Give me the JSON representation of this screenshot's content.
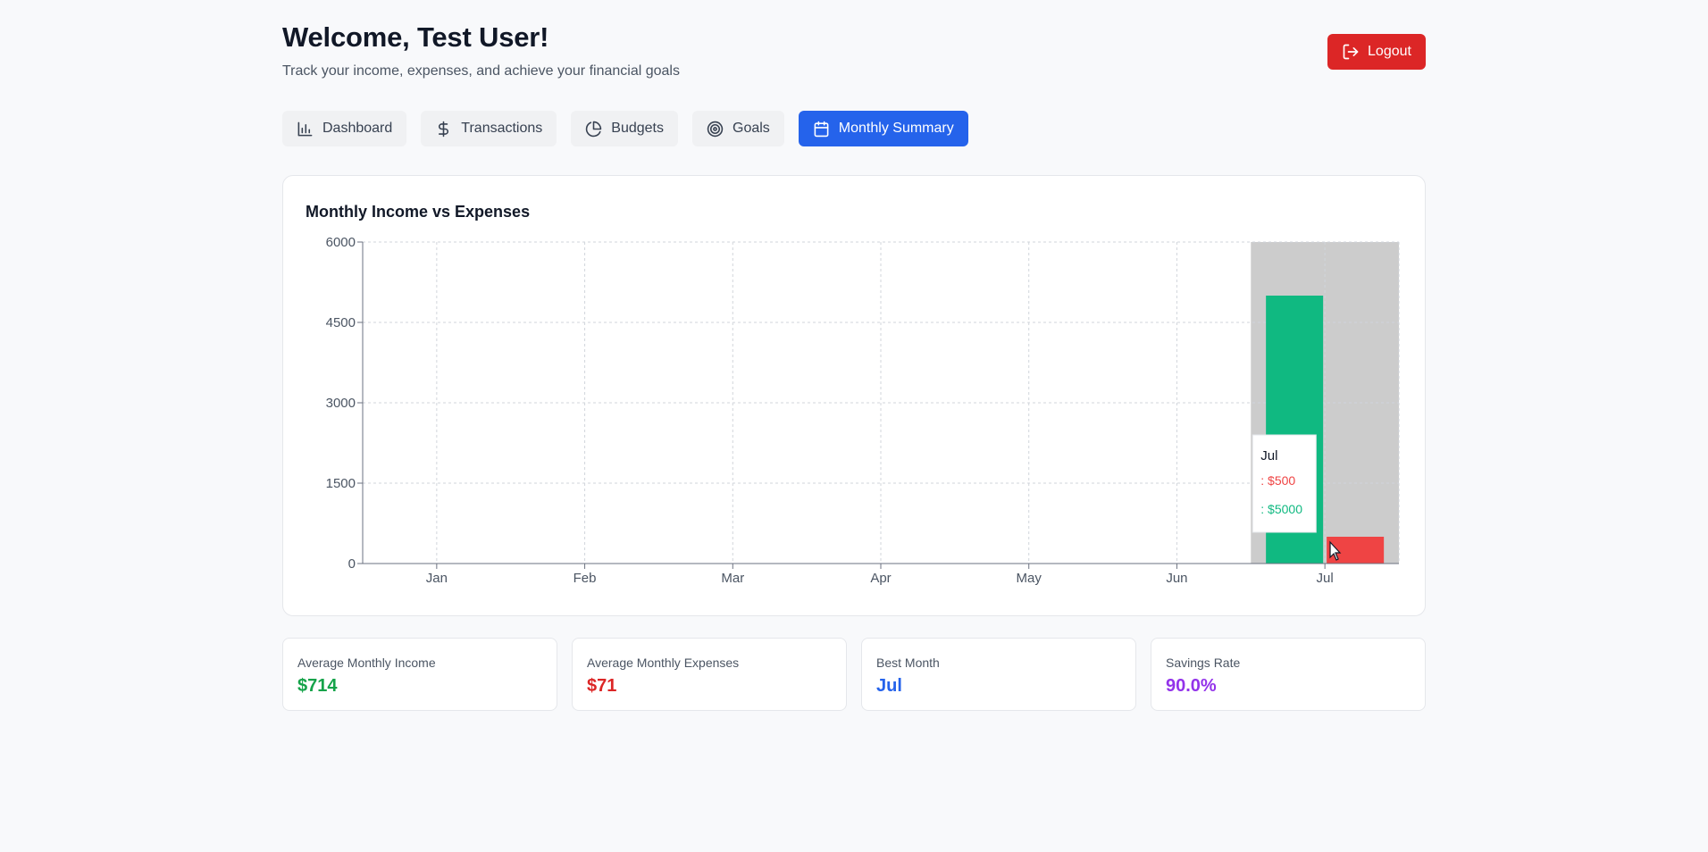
{
  "header": {
    "welcome": "Welcome, Test User!",
    "subtitle": "Track your income, expenses, and achieve your financial goals",
    "logout_label": "Logout"
  },
  "tabs": [
    {
      "label": "Dashboard",
      "icon": "bar-chart-icon"
    },
    {
      "label": "Transactions",
      "icon": "dollar-icon"
    },
    {
      "label": "Budgets",
      "icon": "pie-chart-icon"
    },
    {
      "label": "Goals",
      "icon": "target-icon"
    },
    {
      "label": "Monthly Summary",
      "icon": "calendar-icon",
      "active": true
    }
  ],
  "colors": {
    "accent": "#2563eb",
    "danger": "#dc2626",
    "income": "#10b981",
    "expense": "#ef4444",
    "highlight": "#cccccc"
  },
  "chart_data": {
    "type": "bar",
    "title": "Monthly Income vs Expenses",
    "categories": [
      "Jan",
      "Feb",
      "Mar",
      "Apr",
      "May",
      "Jun",
      "Jul"
    ],
    "series": [
      {
        "name": "",
        "color": "#10b981",
        "values": [
          0,
          0,
          0,
          0,
          0,
          0,
          5000
        ]
      },
      {
        "name": "",
        "color": "#ef4444",
        "values": [
          0,
          0,
          0,
          0,
          0,
          0,
          500
        ]
      }
    ],
    "yticks": [
      "0",
      "1500",
      "3000",
      "4500",
      "6000"
    ],
    "ylim": [
      0,
      6000
    ],
    "grid": true,
    "highlighted_category": "Jul",
    "tooltip": {
      "title": "Jul",
      "expense_text": ": $500",
      "income_text": ": $5000"
    }
  },
  "stats": [
    {
      "label": "Average Monthly Income",
      "value": "$714",
      "color": "green"
    },
    {
      "label": "Average Monthly Expenses",
      "value": "$71",
      "color": "red"
    },
    {
      "label": "Best Month",
      "value": "Jul",
      "color": "blue"
    },
    {
      "label": "Savings Rate",
      "value": "90.0%",
      "color": "purple"
    }
  ]
}
